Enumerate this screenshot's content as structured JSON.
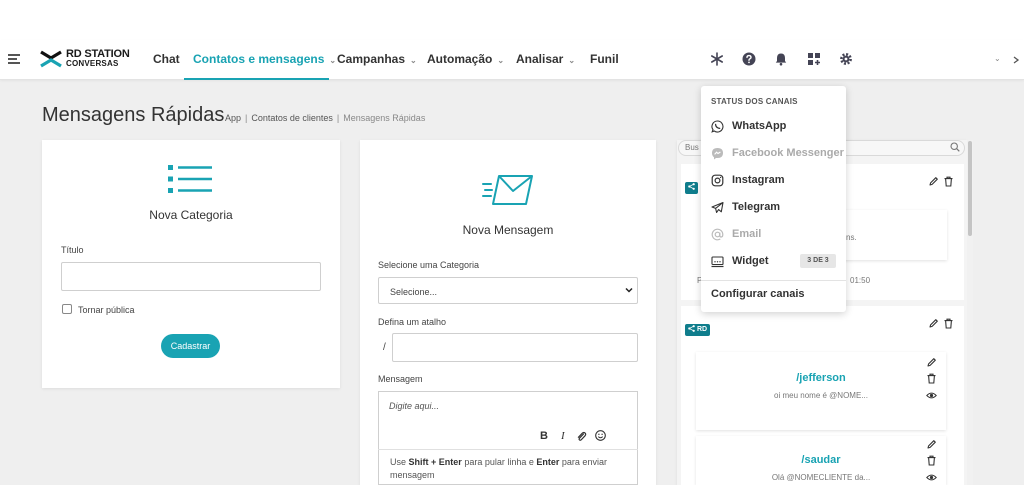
{
  "brand": {
    "line1": "RD STATION",
    "line2": "CONVERSAS"
  },
  "nav": {
    "items": [
      {
        "label": "Chat",
        "dropdown": false
      },
      {
        "label": "Contatos e mensagens",
        "dropdown": true
      },
      {
        "label": "Campanhas",
        "dropdown": true
      },
      {
        "label": "Automação",
        "dropdown": true
      },
      {
        "label": "Analisar",
        "dropdown": true
      },
      {
        "label": "Funil",
        "dropdown": false
      }
    ],
    "active_index": 1,
    "chevron": "⌄",
    "icons": [
      "snowflake-icon",
      "help-icon",
      "bell-icon",
      "apps-icon",
      "gear-icon"
    ]
  },
  "page": {
    "title": "Mensagens Rápidas",
    "breadcrumb": {
      "app": "App",
      "sep": "|",
      "clientes": "Contatos de clientes",
      "current": "Mensagens Rápidas"
    }
  },
  "category_form": {
    "title": "Nova Categoria",
    "titulo_label": "Título",
    "public_label": "Tornar pública",
    "submit_label": "Cadastrar"
  },
  "message_form": {
    "title": "Nova Mensagem",
    "category_label": "Selecione uma Categoria",
    "category_value": "Selecione...",
    "shortcut_label": "Defina um atalho",
    "shortcut_prefix": "/",
    "message_label": "Mensagem",
    "message_placeholder": "Digite aqui...",
    "toolbar": {
      "bold": "B",
      "italic": "I"
    },
    "help": {
      "use": "Use",
      "key1": "Shift + Enter",
      "mid": "para pular linha e",
      "key2": "Enter",
      "end": "para enviar mensagem"
    }
  },
  "messages_panel": {
    "search_placeholder": "Bus",
    "badge_label": "RD",
    "partial_text": "ns.",
    "partial_meta_prefix": "P",
    "partial_meta_time": "01:50",
    "messages": [
      {
        "shortcut": "/jefferson",
        "preview": "oi meu nome é @NOME..."
      },
      {
        "shortcut": "/saudar",
        "preview": "Olá @NOMECLIENTE da..."
      }
    ]
  },
  "channel_status": {
    "heading": "STATUS DOS CANAIS",
    "channels": [
      {
        "label": "WhatsApp",
        "icon": "whatsapp-icon",
        "enabled": true
      },
      {
        "label": "Facebook Messenger",
        "icon": "messenger-icon",
        "enabled": false
      },
      {
        "label": "Instagram",
        "icon": "instagram-icon",
        "enabled": true
      },
      {
        "label": "Telegram",
        "icon": "telegram-icon",
        "enabled": true
      },
      {
        "label": "Email",
        "icon": "at-icon",
        "enabled": false
      },
      {
        "label": "Widget",
        "icon": "widget-icon",
        "enabled": true
      }
    ],
    "widget_badge": "3 DE 3",
    "configure_label": "Configurar canais"
  },
  "colors": {
    "accent": "#19a3b3",
    "badge": "#0f7d8c",
    "notification": "#e83b4a"
  }
}
